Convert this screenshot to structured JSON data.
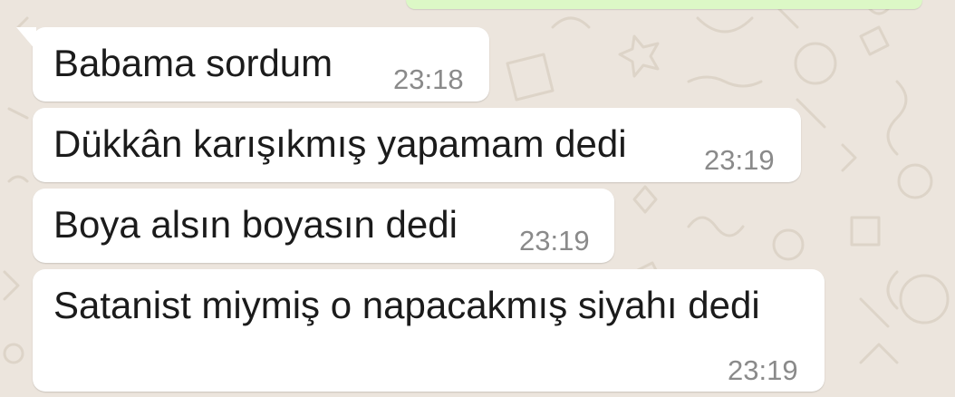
{
  "chat": {
    "messages": [
      {
        "text": "Babama sordum",
        "time": "23:18",
        "direction": "incoming"
      },
      {
        "text": "Dükkân karışıkmış yapamam dedi",
        "time": "23:19",
        "direction": "incoming"
      },
      {
        "text": "Boya alsın boyasın dedi",
        "time": "23:19",
        "direction": "incoming"
      },
      {
        "text": "Satanist miymiş o napacakmış siyahı dedi",
        "time": "23:19",
        "direction": "incoming"
      }
    ]
  },
  "colors": {
    "wallpaper": "#ece5dd",
    "incoming_bubble": "#ffffff",
    "outgoing_bubble": "#dcf8c6",
    "timestamp": "#8a8a8a"
  }
}
